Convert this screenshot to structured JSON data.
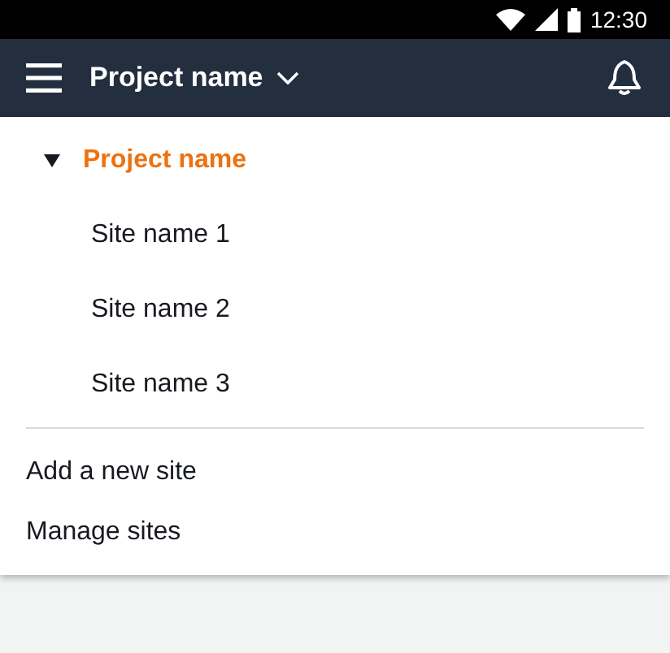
{
  "status_bar": {
    "time": "12:30"
  },
  "header": {
    "title": "Project name"
  },
  "tree": [
    {
      "label": "Project name",
      "expanded": true,
      "selected": true,
      "children": [
        {
          "label": "Site name 1",
          "selected": false
        },
        {
          "label": "Site name 2",
          "selected": false
        },
        {
          "label": "Site name 3",
          "selected": false
        }
      ]
    }
  ],
  "actions": [
    {
      "label": "Add a new site"
    },
    {
      "label": "Manage sites"
    }
  ]
}
